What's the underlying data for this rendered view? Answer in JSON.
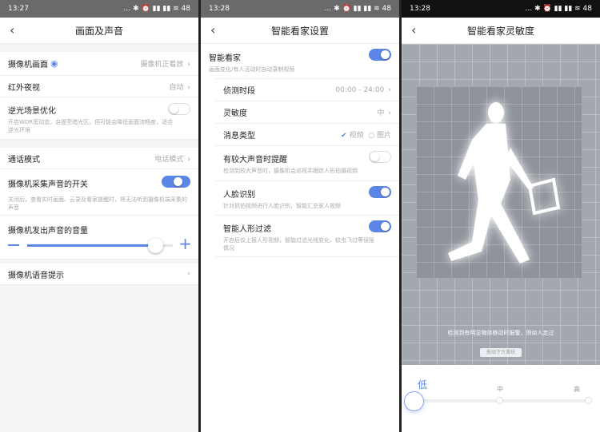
{
  "accent": "#5b86e5",
  "screen1": {
    "time": "13:27",
    "battery": "48",
    "title": "画面及声音",
    "rows": [
      {
        "label": "摄像机画面",
        "value": "摄像机正着放"
      },
      {
        "label": "红外夜视",
        "value": "自动"
      },
      {
        "label": "逆光场景优化",
        "desc": "开启WDR宽动态，会提亮暗光区，但可能会降低画面流畅度，适合逆光环境",
        "on": false
      },
      {
        "label": "通话模式",
        "value": "电话模式"
      },
      {
        "label": "摄像机采集声音的开关",
        "desc": "关闭后，查看实时画面、云录及看家提醒时，将无法听到摄像机端采集的声音",
        "toggle_text": "开",
        "on": true
      },
      {
        "label": "摄像机发出声音的音量",
        "volume_percent": 88
      },
      {
        "label": "摄像机语音提示"
      }
    ]
  },
  "screen2": {
    "time": "13:28",
    "battery": "48",
    "title": "智能看家设置",
    "main": {
      "label": "智能看家",
      "desc": "画面变化/有人活动时自动录制视频",
      "on": true
    },
    "period": {
      "label": "侦测时段",
      "value": "00:00 - 24:00"
    },
    "sensitivity": {
      "label": "灵敏度",
      "value": "中"
    },
    "msg": {
      "label": "消息类型",
      "opt1": "视频",
      "opt2": "图片"
    },
    "loud": {
      "label": "有较大声音时提醒",
      "desc": "检测到较大声音时，摄像机会巡视并跟踪人形拍摄视频",
      "on": false
    },
    "face": {
      "label": "人脸识别",
      "desc": "针对抓拍视频进行人脸识别，智能汇总家人视频",
      "on": true
    },
    "human": {
      "label": "智能人形过滤",
      "desc": "开启后仅上报人形视频，智能过滤光线变化、蚊虫飞过等误报情况",
      "on": true
    }
  },
  "screen3": {
    "time": "13:28",
    "battery": "48",
    "title": "智能看家灵敏度",
    "hint": "检测到有明显物体移动时报警，例如人走过",
    "tip": "拖动下方滑块",
    "levels": [
      "低",
      "中",
      "高"
    ],
    "selected": 0
  }
}
